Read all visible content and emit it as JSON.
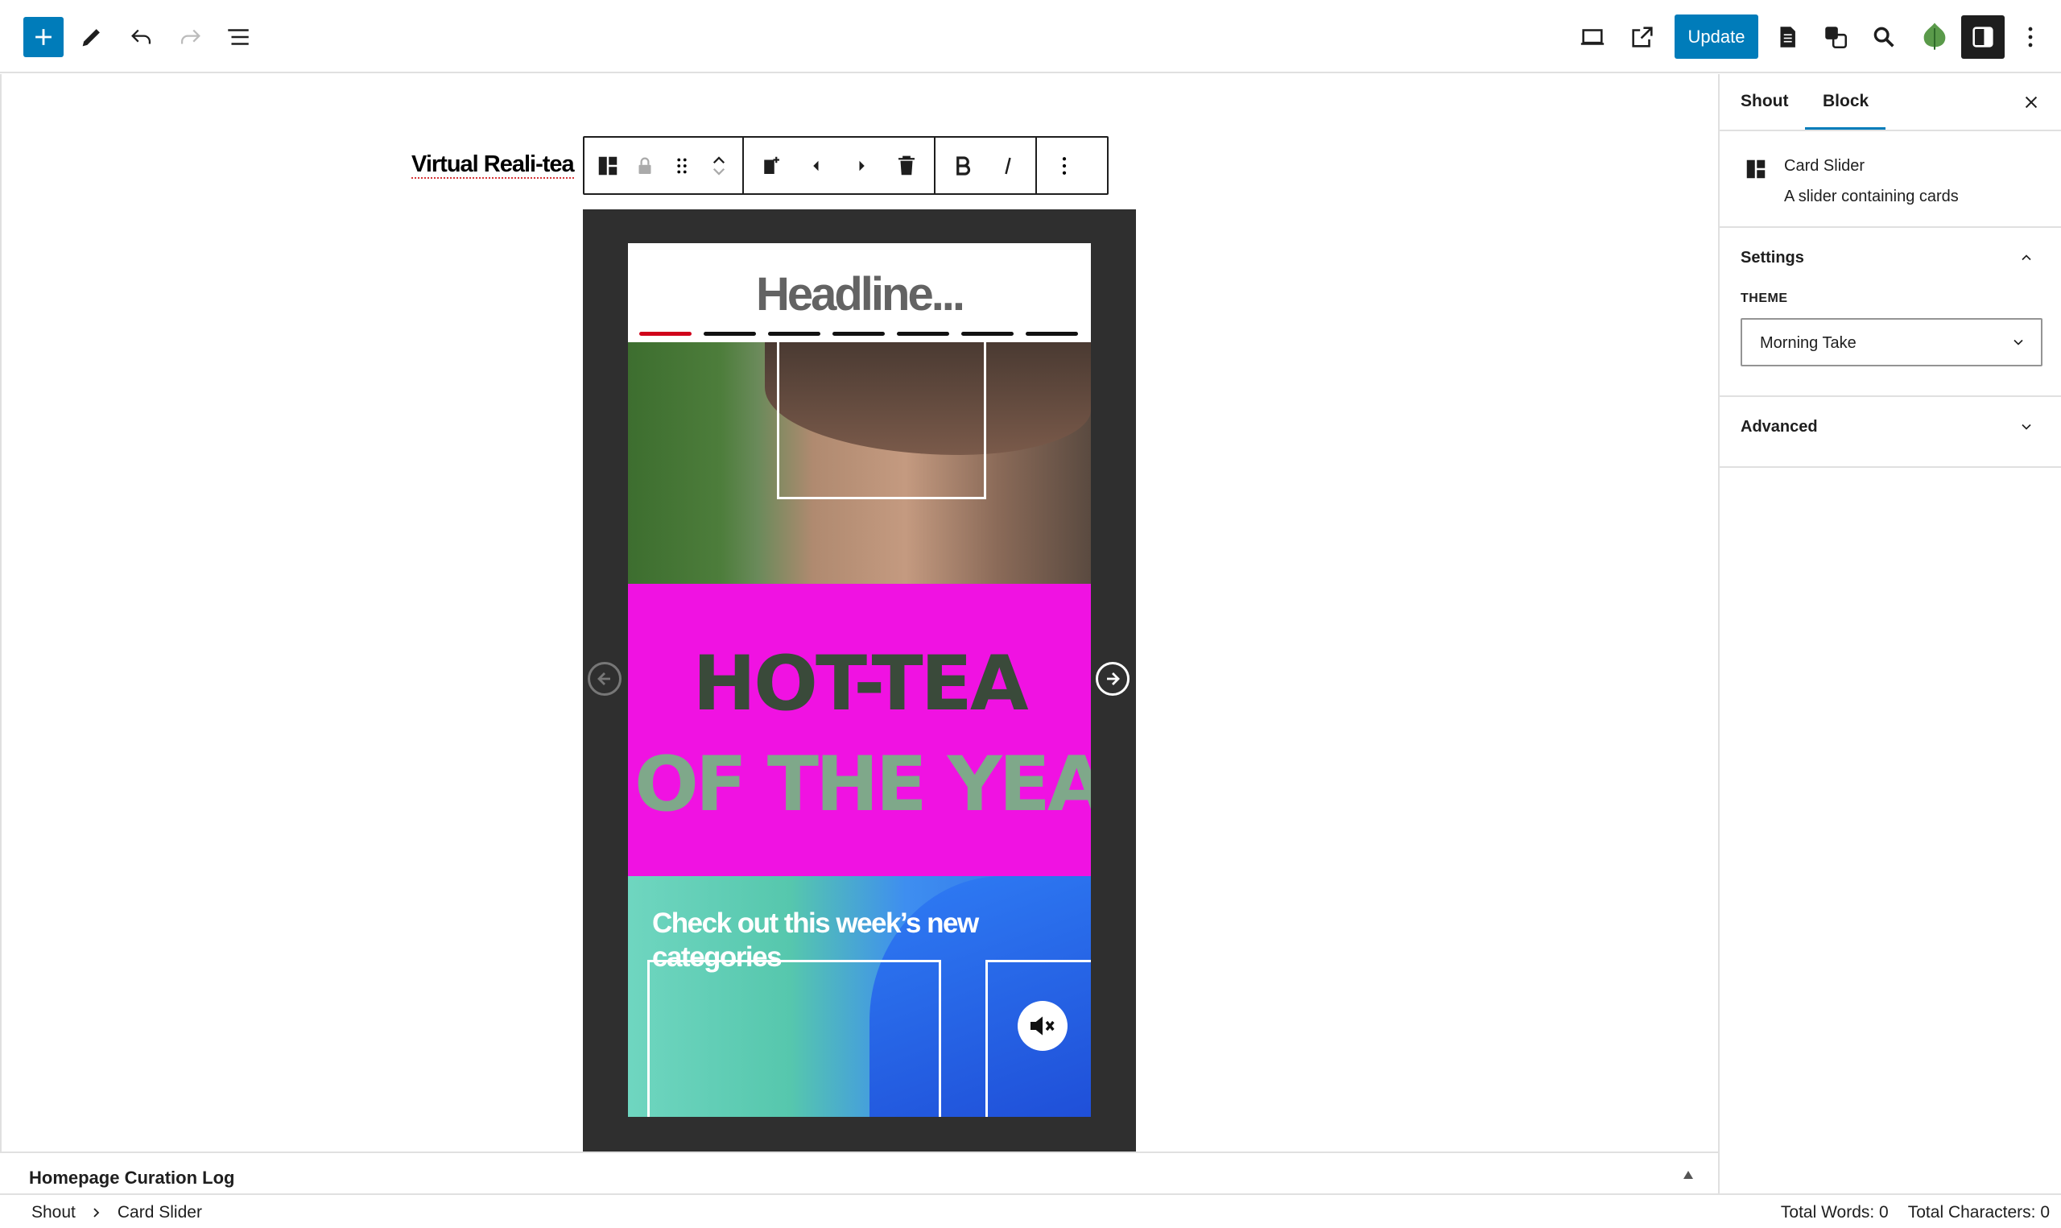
{
  "toolbar": {
    "update_label": "Update",
    "icons": [
      "add-block-icon",
      "edit-icon",
      "undo-icon",
      "redo-icon",
      "list-view-icon",
      "desktop-preview-icon",
      "external-preview-icon",
      "document-icon",
      "translate-icon",
      "search-icon",
      "leaf-avatar-icon",
      "settings-panel-icon",
      "more-options-icon"
    ],
    "accent_color": "#007cba"
  },
  "editor": {
    "post_title": "Virtual Reali-tea",
    "card": {
      "headline": "Headline...",
      "progress_segments": 7,
      "active_segment": 1,
      "hero_line1": "HOT-TEA",
      "hero_line2": "OF THE YEAR",
      "tagline": "Check out this week’s new categories",
      "band_color": "#f012e2"
    }
  },
  "meta_panel": {
    "title": "Homepage Curation Log"
  },
  "footer": {
    "breadcrumb": [
      "Shout",
      "Card Slider"
    ],
    "total_words": "Total Words: 0",
    "total_characters": "Total Characters: 0"
  },
  "sidebar": {
    "tabs": [
      "Shout",
      "Block"
    ],
    "active_tab": "Block",
    "block": {
      "title": "Card Slider",
      "description": "A slider containing cards"
    },
    "settings": {
      "heading": "Settings",
      "theme_label": "THEME",
      "theme_value": "Morning Take"
    },
    "advanced": {
      "heading": "Advanced"
    }
  }
}
